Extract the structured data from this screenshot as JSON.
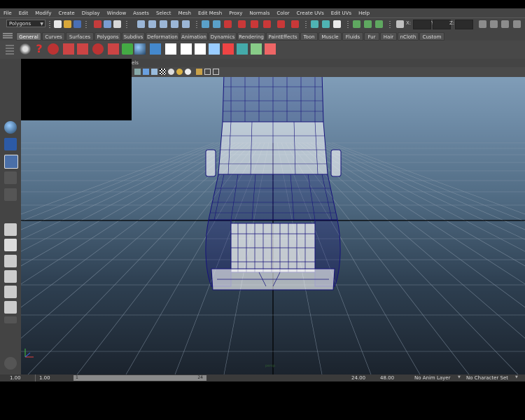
{
  "menubar": {
    "items": [
      "File",
      "Edit",
      "Modify",
      "Create",
      "Display",
      "Window",
      "Assets",
      "Select",
      "Mesh",
      "Edit Mesh",
      "Proxy",
      "Normals",
      "Color",
      "Create UVs",
      "Edit UVs",
      "Help"
    ]
  },
  "statusline": {
    "mode": "Polygons",
    "x_label": "X:",
    "y_label": "Y:",
    "z_label": "Z:"
  },
  "shelf": {
    "tabs": [
      "General",
      "Curves",
      "Surfaces",
      "Polygons",
      "Subdivs",
      "Deformation",
      "Animation",
      "Dynamics",
      "Rendering",
      "PaintEffects",
      "Toon",
      "Muscle",
      "Fluids",
      "Fur",
      "Hair",
      "nCloth",
      "Custom"
    ],
    "active_tab": "General"
  },
  "viewport": {
    "menu_fragment": "els",
    "camera_label": "persp"
  },
  "timebar": {
    "start_time": "1.00",
    "playback_start": "1.00",
    "range_start_frame": "1",
    "range_end_frame": "24",
    "playback_end": "24.00",
    "end_time": "48.00",
    "anim_layer": "No Anim Layer",
    "character_set": "No Character Set"
  },
  "colors": {
    "wire_color": "#16127a",
    "ui_gray": "#444444",
    "grid_line": "#8a9aab"
  }
}
